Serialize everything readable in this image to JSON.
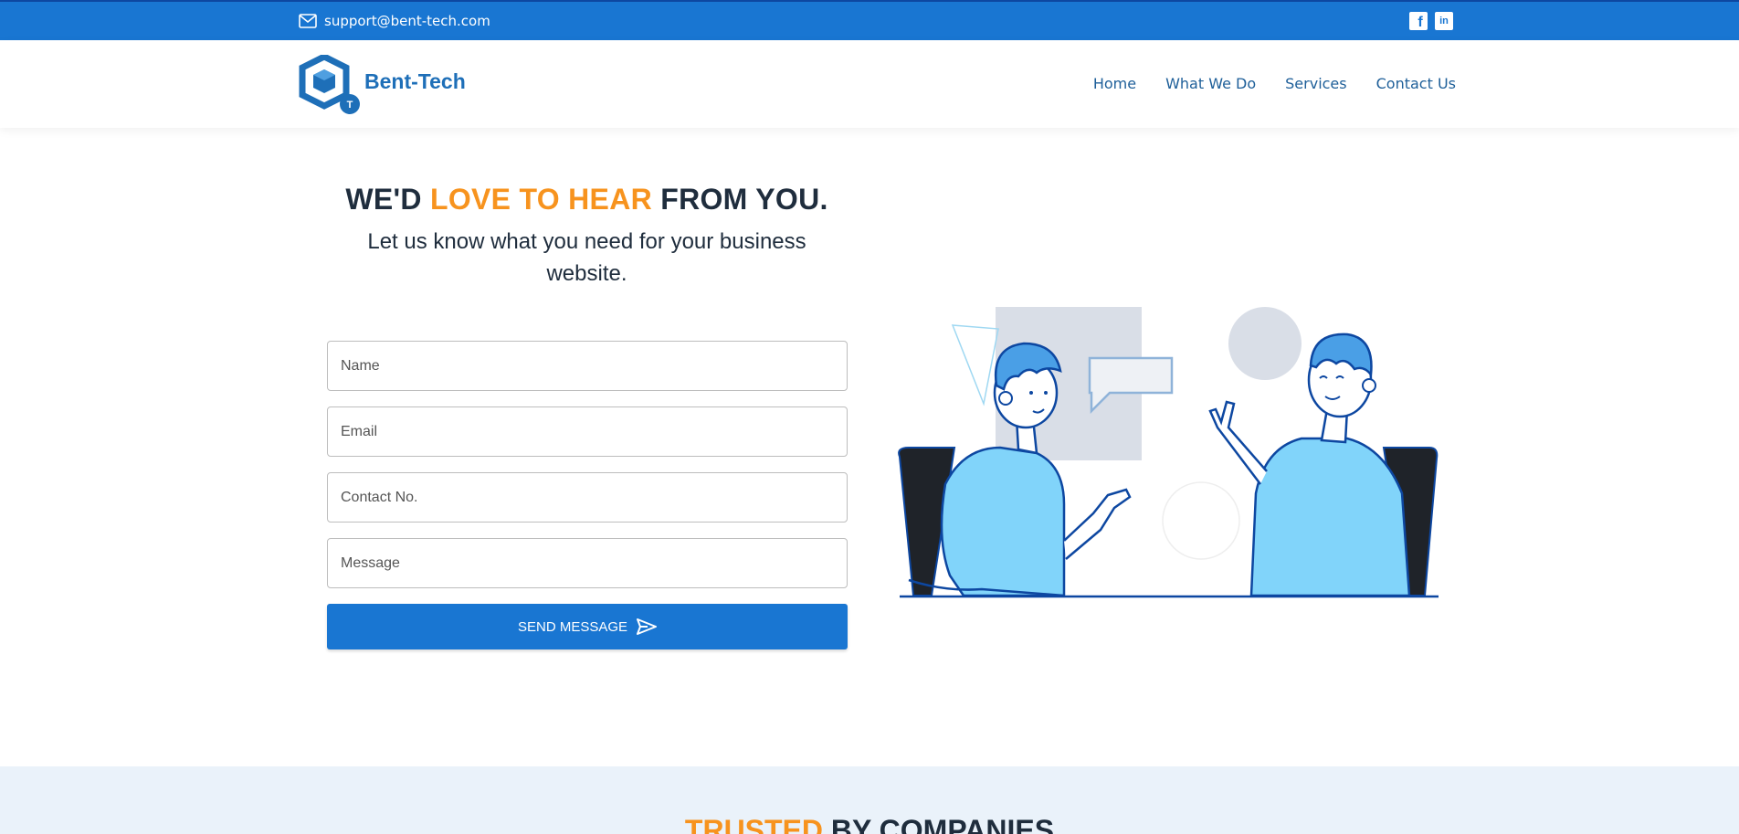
{
  "topbar": {
    "email": "support@bent-tech.com",
    "social": [
      {
        "name": "facebook-icon",
        "glyph": "f"
      },
      {
        "name": "linkedin-icon",
        "glyph": "in"
      }
    ]
  },
  "brand": {
    "name": "Bent-Tech",
    "primary_color": "#1976d2",
    "accent_color": "#f7931e"
  },
  "nav": {
    "items": [
      {
        "label": "Home"
      },
      {
        "label": "What We Do"
      },
      {
        "label": "Services"
      },
      {
        "label": "Contact Us"
      }
    ]
  },
  "hero": {
    "title_part1": "WE'D ",
    "title_accent": "LOVE TO HEAR",
    "title_part2": " FROM YOU.",
    "subtitle": "Let us know what you need for your business website."
  },
  "form": {
    "name_placeholder": "Name",
    "email_placeholder": "Email",
    "contact_placeholder": "Contact No.",
    "message_placeholder": "Message",
    "submit_label": "SEND MESSAGE"
  },
  "trusted": {
    "title_accent": "TRUSTED",
    "title_rest": " BY COMPANIES"
  }
}
